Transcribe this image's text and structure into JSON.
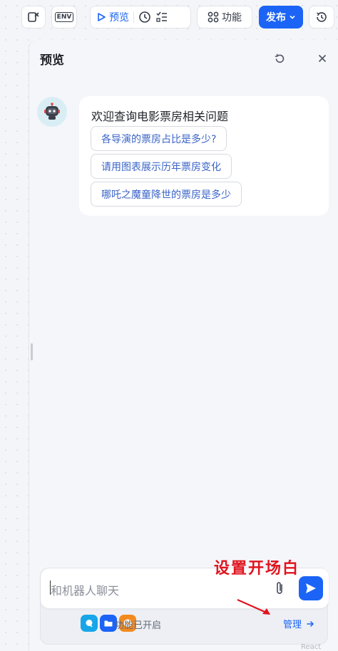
{
  "toolbar": {
    "preview_label": "预览",
    "features_label": "功能",
    "publish_label": "发布",
    "env_label": "ENV"
  },
  "panel": {
    "title": "预览",
    "welcome": "欢迎查询电影票房相关问题",
    "suggestions": [
      "各导演的票房占比是多少?",
      "请用图表展示历年票房变化",
      "哪吒之魔童降世的票房是多少"
    ]
  },
  "input": {
    "placeholder": "和机器人聊天",
    "features_status": "功能已开启",
    "manage_label": "管理"
  },
  "annotation": {
    "text": "设置开场白"
  },
  "footer": {
    "corner": "React Flow"
  },
  "colors": {
    "accent": "#1b64f5",
    "annotation": "#e0141e",
    "link": "#3a64c8"
  }
}
